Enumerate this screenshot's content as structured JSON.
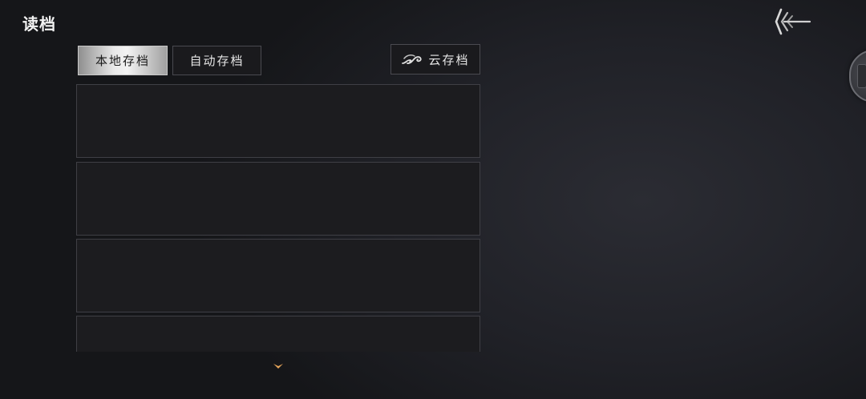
{
  "header": {
    "title": "读档",
    "back_icon": "back-arrow-icon"
  },
  "tabs": {
    "local_label": "本地存档",
    "auto_label": "自动存档",
    "active": "local"
  },
  "cloud": {
    "label": "云存档",
    "icon": "cloud-icon"
  },
  "slots": [
    {
      "empty": true
    },
    {
      "empty": true
    },
    {
      "empty": true
    },
    {
      "empty": true
    }
  ],
  "scroll": {
    "icon": "chevron-down-icon",
    "accent": "#e8a65a"
  },
  "colors": {
    "tab_active": "#e9e9e9",
    "panel_bg": "#1c1c1f",
    "panel_border": "#3f3f45"
  }
}
